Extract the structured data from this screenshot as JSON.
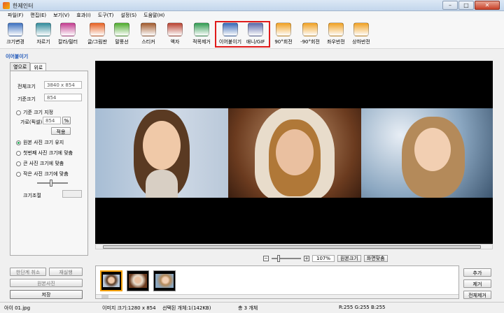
{
  "window": {
    "title": "한제인터"
  },
  "menu": [
    "파일(F)",
    "편집(E)",
    "보기(V)",
    "효과(I)",
    "도구(T)",
    "설정(S)",
    "도움말(H)"
  ],
  "toolbar": [
    {
      "label": "크기변경",
      "icon": "resize-icon",
      "color": "#3b6fbf"
    },
    {
      "label": "자르기",
      "icon": "crop-icon",
      "color": "#2f8a9a"
    },
    {
      "label": "칼라/필터",
      "icon": "color-filter-icon",
      "color": "#c23a8e"
    },
    {
      "label": "글/그림판",
      "icon": "text-draw-icon",
      "color": "#e65f1f"
    },
    {
      "label": "말풍선",
      "icon": "speech-bubble-icon",
      "color": "#4caa2b"
    },
    {
      "label": "스티커",
      "icon": "sticker-icon",
      "color": "#a0582a"
    },
    {
      "label": "액자",
      "icon": "frame-icon",
      "color": "#b8402f"
    },
    {
      "label": "적목제거",
      "icon": "red-eye-icon",
      "color": "#2f9a4f"
    },
    {
      "label": "이어붙이기",
      "icon": "merge-icon",
      "color": "#3565b5"
    },
    {
      "label": "애니/GIF",
      "icon": "gif-icon",
      "color": "#5a67a8"
    },
    {
      "label": "90°회전",
      "icon": "rotate-right-icon",
      "color": "#f0a020"
    },
    {
      "label": "-90°회전",
      "icon": "rotate-left-icon",
      "color": "#f0a020"
    },
    {
      "label": "좌우반전",
      "icon": "flip-horizontal-icon",
      "color": "#f0a020"
    },
    {
      "label": "상하반전",
      "icon": "flip-vertical-icon",
      "color": "#f0a020"
    }
  ],
  "left": {
    "title": "이어붙이기",
    "tabs": [
      "옆으로",
      "위로"
    ],
    "total_size_label": "전체크기",
    "total_size_value": "3840 x 854",
    "base_size_label": "기준크기",
    "base_size_value": "854",
    "opt_base": "기준 크기 지정",
    "width_label": "가로(픽셀)",
    "width_value": "854",
    "apply": "적용",
    "opt_keep": "원본 사진 크기 유지",
    "opt_first": "첫번째 사진 크기에 맞춤",
    "opt_large": "큰 사진 크기에 맞춤",
    "opt_small": "작은 사진 크기에 맞춤",
    "size_adjust": "크기조절"
  },
  "zoom": {
    "value": "107%",
    "original": "원본크기",
    "fit": "화면맞춤"
  },
  "bottom_left": {
    "undo": "한단계 취소",
    "redo": "재실행",
    "original_photo": "원본사진",
    "save": "저장"
  },
  "right_buttons": {
    "add": "추가",
    "remove": "제거",
    "remove_all": "전체제거"
  },
  "status": {
    "file": "아이 01.jpg",
    "image_size": "이미지 크기:1280 x 854",
    "selected": "선택된 개체:1(142KB)",
    "count": "총 3 개체",
    "rgb": "R:255 G:255 B:255"
  },
  "colors": {
    "highlight": "#e01b1b",
    "accent": "#1c55b8"
  }
}
